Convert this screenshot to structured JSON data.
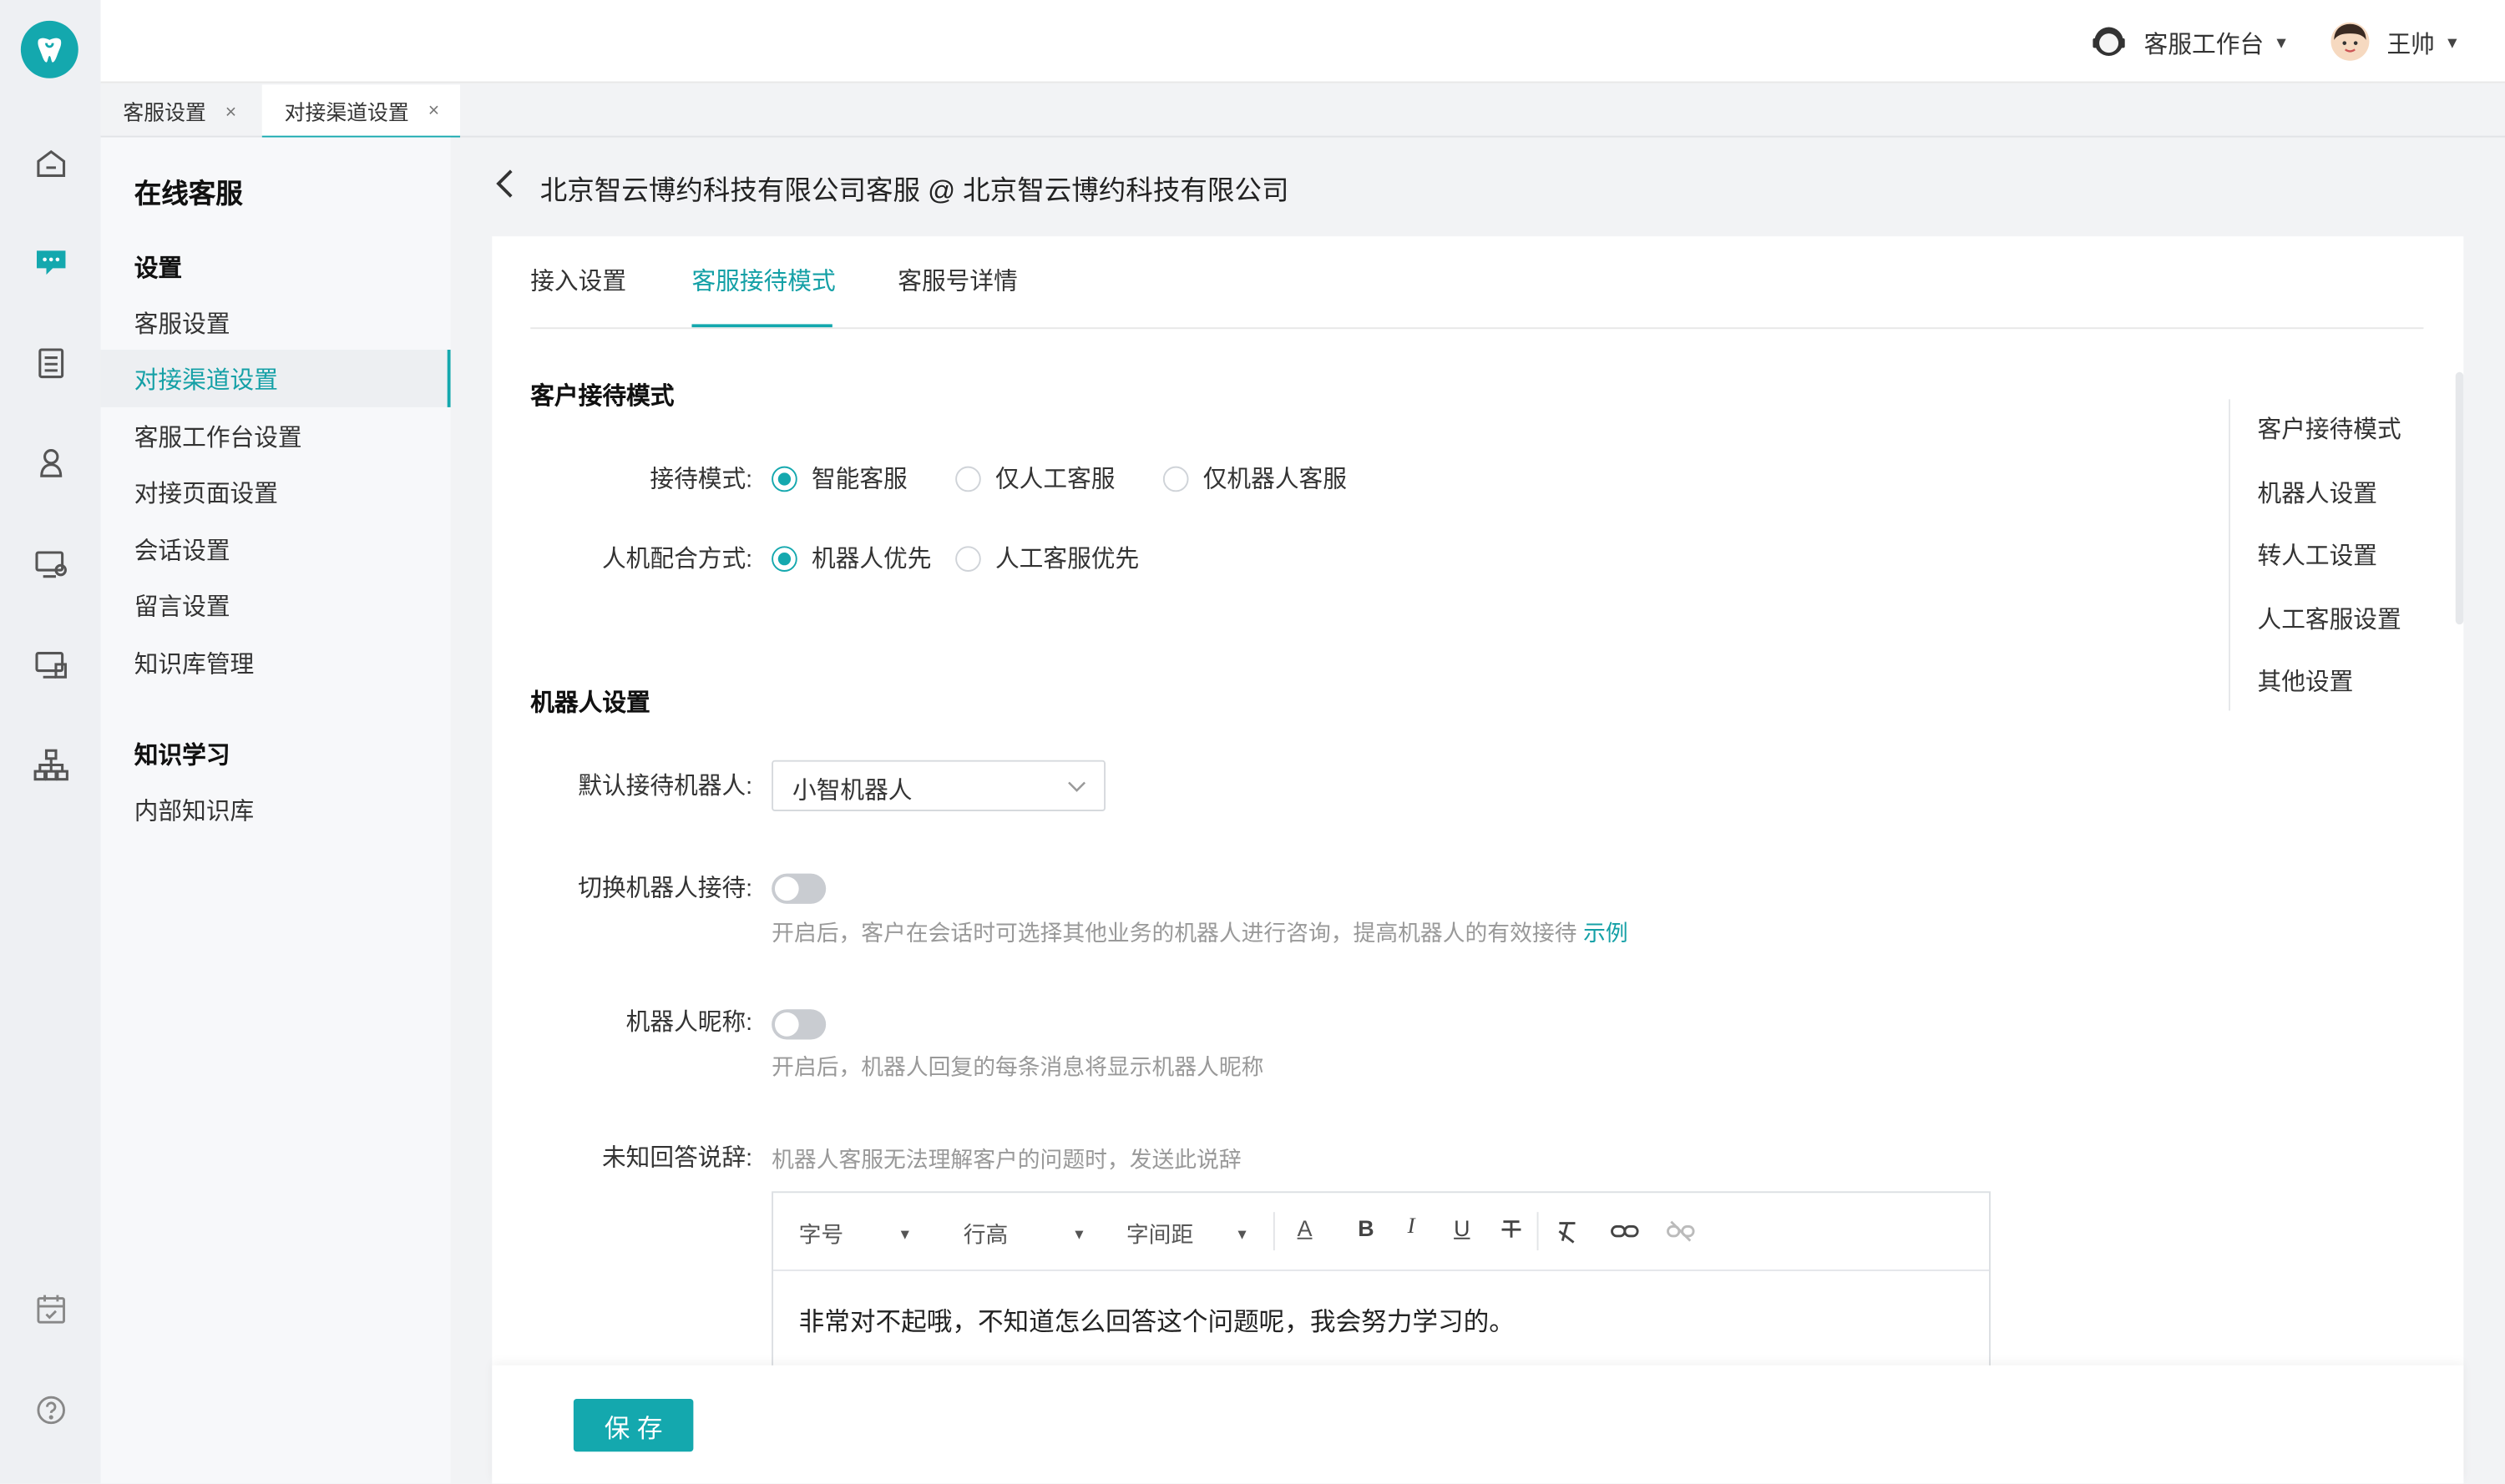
{
  "topbar": {
    "workbench_label": "客服工作台",
    "user_name": "王帅"
  },
  "open_tabs": [
    {
      "label": "客服设置",
      "close": "×"
    },
    {
      "label": "对接渠道设置",
      "close": "×"
    }
  ],
  "sidebar": {
    "title": "在线客服",
    "group1": "设置",
    "items": [
      "客服设置",
      "对接渠道设置",
      "客服工作台设置",
      "对接页面设置",
      "会话设置",
      "留言设置",
      "知识库管理"
    ],
    "group2": "知识学习",
    "items2": [
      "内部知识库"
    ]
  },
  "page": {
    "back": "‹",
    "title": "北京智云博约科技有限公司客服 @ 北京智云博约科技有限公司"
  },
  "tabs": [
    "接入设置",
    "客服接待模式",
    "客服号详情"
  ],
  "sections": {
    "reception": "客户接待模式",
    "robot": "机器人设置"
  },
  "form": {
    "mode_label": "接待模式:",
    "mode_options": [
      "智能客服",
      "仅人工客服",
      "仅机器人客服"
    ],
    "coop_label": "人机配合方式:",
    "coop_options": [
      "机器人优先",
      "人工客服优先"
    ],
    "default_robot_label": "默认接待机器人:",
    "default_robot_value": "小智机器人",
    "switch_robot_label": "切换机器人接待:",
    "switch_robot_hint": "开启后，客户在会话时可选择其他业务的机器人进行咨询，提高机器人的有效接待",
    "switch_robot_link": "示例",
    "nickname_label": "机器人昵称:",
    "nickname_hint": "开启后，机器人回复的每条消息将显示机器人昵称",
    "unknown_label": "未知回答说辞:",
    "unknown_hint": "机器人客服无法理解客户的问题时，发送此说辞",
    "editor_text": "非常对不起哦，不知道怎么回答这个问题呢，我会努力学习的。"
  },
  "editor_toolbar": {
    "font_size": "字号",
    "line_height": "行高",
    "letter_spacing": "字间距",
    "font_color": "A",
    "bold": "B",
    "italic": "I",
    "underline": "U"
  },
  "anchors": [
    "客户接待模式",
    "机器人设置",
    "转人工设置",
    "人工客服设置",
    "其他设置"
  ],
  "save_label": "保 存",
  "colors": {
    "accent": "#14a8ae",
    "link": "#14a0a6"
  }
}
